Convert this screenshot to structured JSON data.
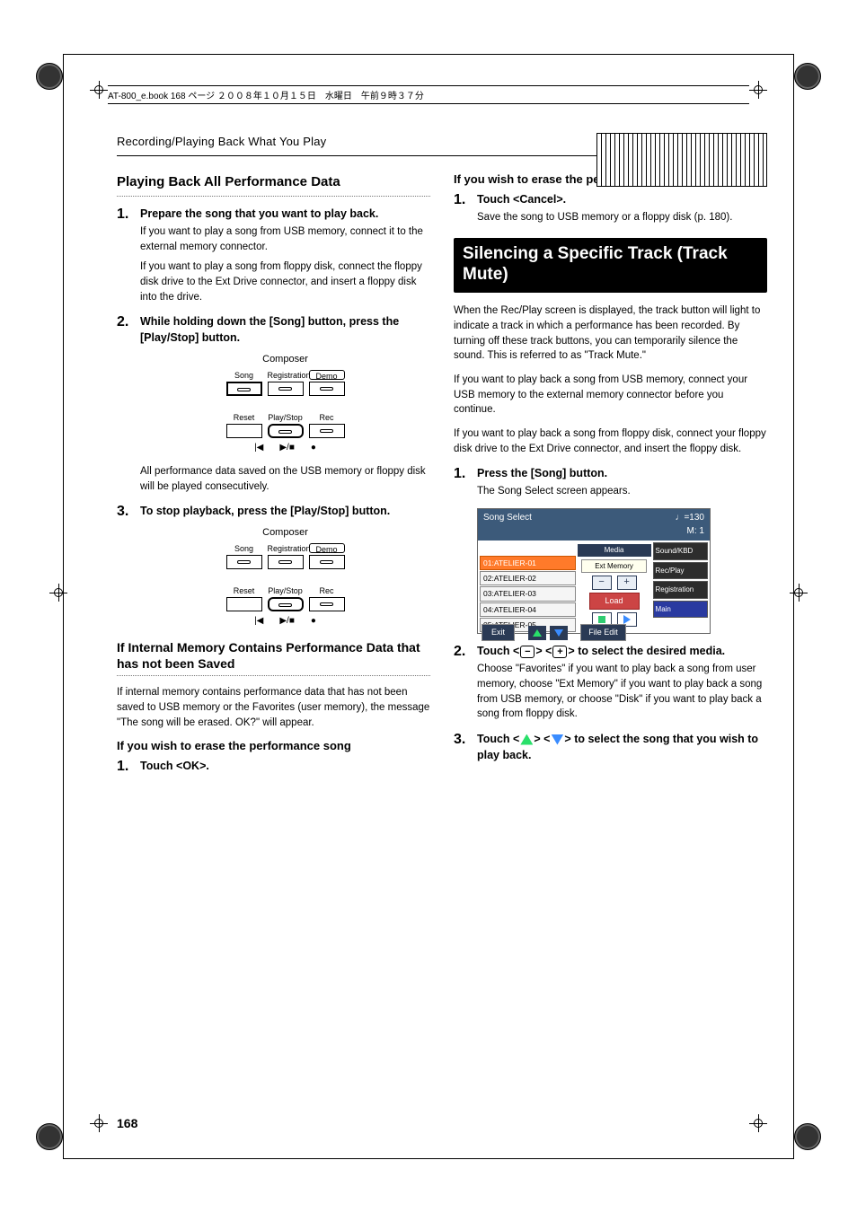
{
  "book_header": "AT-800_e.book  168 ページ  ２００８年１０月１５日　水曜日　午前９時３７分",
  "breadcrumb": "Recording/Playing Back What You Play",
  "page_number": "168",
  "left": {
    "h1": "Playing Back All Performance Data",
    "steps": [
      {
        "num": "1.",
        "title": "Prepare the song that you want to play back.",
        "body": [
          "If you want to play a song from USB memory, connect it to the external memory connector.",
          "If you want to play a song from floppy disk, connect the floppy disk drive to the Ext Drive connector, and insert a floppy disk into the drive."
        ]
      },
      {
        "num": "2.",
        "title": "While holding down the [Song] button, press the [Play/Stop] button.",
        "after_fig_text": "All performance data saved on the USB memory or floppy disk will be played consecutively."
      },
      {
        "num": "3.",
        "title": "To stop playback, press the [Play/Stop] button."
      }
    ],
    "fig": {
      "title": "Composer",
      "row1": [
        "Song",
        "Registration",
        "Demo"
      ],
      "row2": [
        "Reset",
        "Play/Stop",
        "Rec"
      ],
      "transport": [
        "|◀",
        "▶/■",
        "●"
      ]
    },
    "h_unsaved": "If Internal Memory Contains Performance Data that has not been Saved",
    "unsaved_para": "If internal memory contains performance data that has not been saved to USB memory or the Favorites (user memory), the message \"The song will be erased. OK?\" will appear.",
    "h_erase1": "If you wish to erase the performance song",
    "erase1_step": {
      "num": "1.",
      "title": "Touch <OK>."
    }
  },
  "right": {
    "h_erase2": "If you wish to erase the performance song",
    "erase2_step": {
      "num": "1.",
      "title": "Touch <Cancel>.",
      "body": "Save the song to USB memory or a floppy disk (p. 180)."
    },
    "banner": "Silencing a Specific Track (Track Mute)",
    "para1": "When the Rec/Play screen is displayed, the track button will light to indicate a track in which a performance has been recorded. By turning off these track buttons, you can temporarily silence the sound. This is referred to as \"Track Mute.\"",
    "para2": "If you want to play back a song from USB memory, connect your USB memory to the external memory connector before you continue.",
    "para3": "If you want to play back a song from floppy disk, connect your floppy disk drive to the Ext Drive connector, and insert the floppy disk.",
    "steps": [
      {
        "num": "1.",
        "title": "Press the [Song] button.",
        "body": "The Song Select screen appears."
      },
      {
        "num": "2.",
        "title_pre": "Touch <",
        "title_mid": "> <",
        "title_post": "> to select the desired media.",
        "body": "Choose \"Favorites\" if you want to play back a song from user memory, choose \"Ext Memory\" if you want to play back a song from USB memory, or choose \"Disk\" if you want to play back a song from floppy disk."
      },
      {
        "num": "3.",
        "title_pre": "Touch <",
        "title_mid": "> <",
        "title_post": "> to select the song that you wish to play back."
      }
    ],
    "screenshot": {
      "title": "Song Select",
      "tempo_label": "♩=130",
      "measure_label": "M:    1",
      "media_header": "Media",
      "media_value": "Ext Memory",
      "list": [
        "01:ATELIER-01",
        "02:ATELIER-02",
        "03:ATELIER-03",
        "04:ATELIER-04",
        "05:ATELIER-05"
      ],
      "load": "Load",
      "side": [
        "Sound/KBD",
        "Rec/Play",
        "Registration",
        "Main"
      ],
      "exit": "Exit",
      "file_edit": "File Edit"
    }
  }
}
